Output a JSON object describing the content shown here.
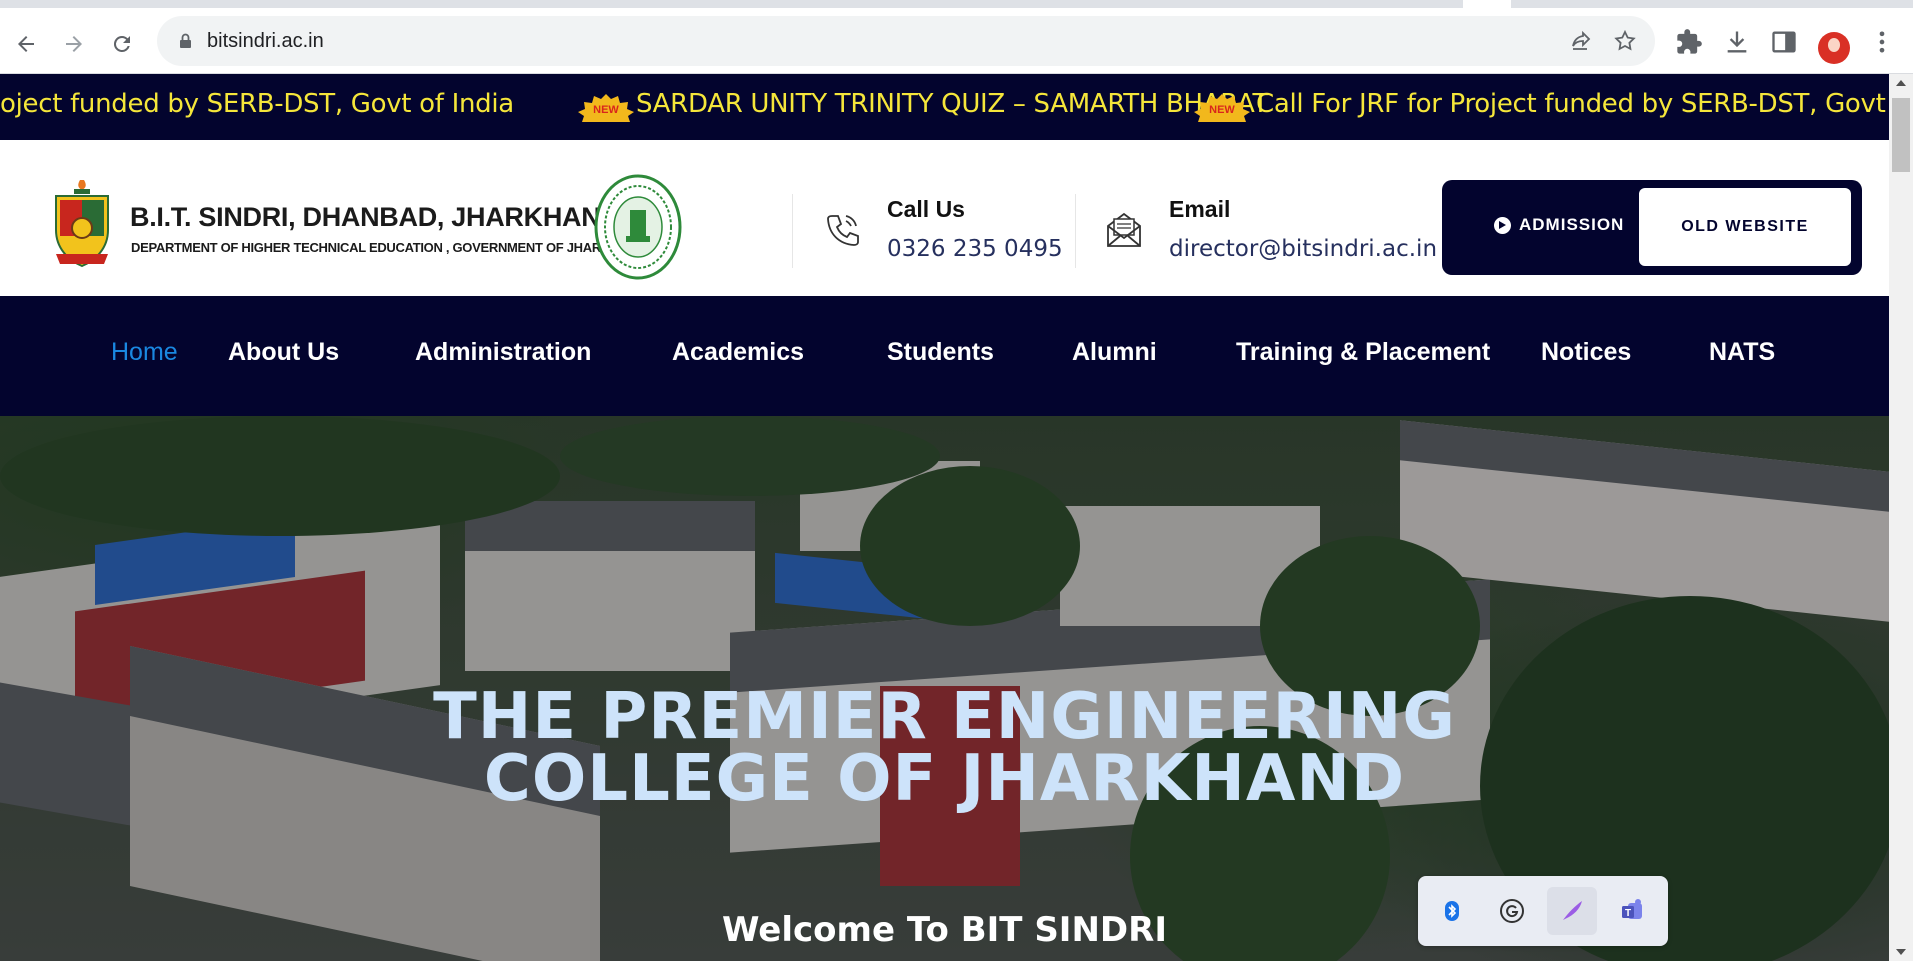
{
  "browser": {
    "url": "bitsindri.ac.in",
    "icons": [
      "back-icon",
      "forward-icon",
      "reload-icon",
      "lock-icon",
      "share-icon",
      "star-icon",
      "extensions-icon",
      "download-icon",
      "sidepanel-icon",
      "profile-avatar",
      "menu-icon"
    ]
  },
  "ticker": {
    "items": [
      "oject funded by SERB-DST, Govt of India",
      "SARDAR UNITY TRINITY QUIZ – SAMARTH BHARAT",
      "Call For JRF for Project funded by SERB-DST, Govt of I"
    ],
    "badge": "NEW",
    "text_color": "#f5e63a",
    "bg_color": "#03042e"
  },
  "header": {
    "institute_name": "B.I.T. SINDRI, DHANBAD, JHARKHAND",
    "institute_sub": "DEPARTMENT OF HIGHER TECHNICAL EDUCATION , GOVERNMENT OF JHARKHAND",
    "call_title": "Call Us",
    "call_value": "0326 235 0495",
    "email_title": "Email",
    "email_value": "director@bitsindri.ac.in",
    "admission_label": "ADMISSION",
    "old_website_label": "OLD WEBSITE"
  },
  "nav": {
    "items": [
      "Home",
      "About Us",
      "Administration",
      "Academics",
      "Students",
      "Alumni",
      "Training & Placement",
      "Notices",
      "NATS"
    ],
    "active": "Home",
    "active_color": "#1a88e1"
  },
  "hero": {
    "title_line1": "THE PREMIER ENGINEERING",
    "title_line2": "COLLEGE OF JHARKHAND",
    "welcome": "Welcome To BIT SINDRI"
  },
  "extension_popup": {
    "icons": [
      "bluetooth-icon",
      "grammarly-icon",
      "quill-icon",
      "teams-icon"
    ]
  }
}
